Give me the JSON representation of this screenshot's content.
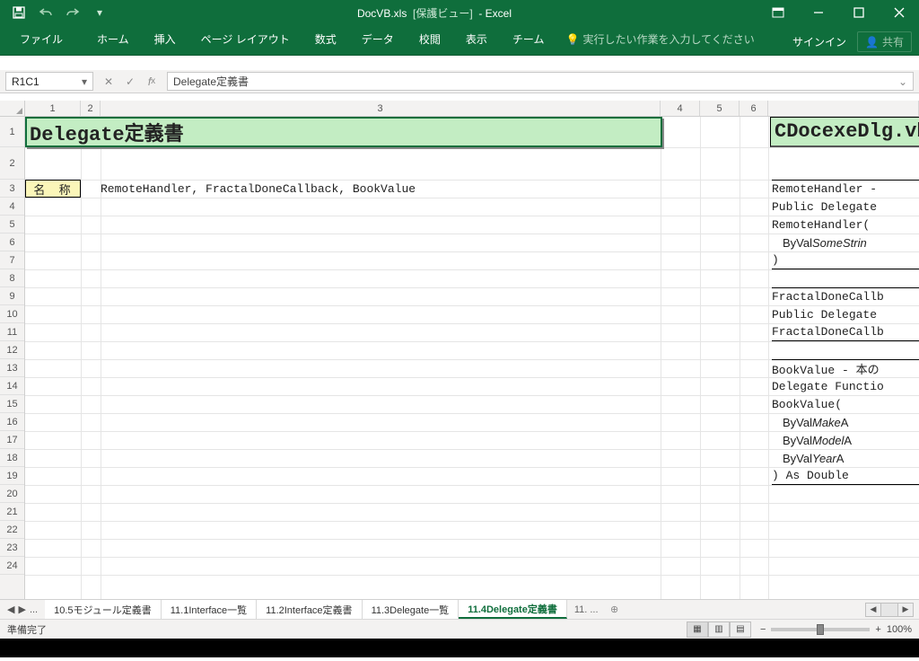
{
  "titlebar": {
    "filename": "DocVB.xls",
    "mode": "[保護ビュー]",
    "app": "Excel"
  },
  "ribbon": {
    "tabs": [
      "ファイル",
      "ホーム",
      "挿入",
      "ページ レイアウト",
      "数式",
      "データ",
      "校閲",
      "表示",
      "チーム"
    ],
    "tell": "実行したい作業を入力してください",
    "signin": "サインイン",
    "share": "共有"
  },
  "fx": {
    "namebox": "R1C1",
    "formula": "Delegate定義書"
  },
  "columns": [
    "1",
    "2",
    "3",
    "4",
    "5",
    "6"
  ],
  "rows": [
    "1",
    "2",
    "3",
    "4",
    "5",
    "6",
    "7",
    "8",
    "9",
    "10",
    "11",
    "12",
    "13",
    "14",
    "15",
    "16",
    "17",
    "18",
    "19",
    "20",
    "21",
    "22",
    "23",
    "24"
  ],
  "cells": {
    "title_left": "Delegate定義書",
    "title_right": "CDocexeDlg.vb",
    "row3_label": "名 称",
    "row3_value": "RemoteHandler, FractalDoneCallback, BookValue"
  },
  "code": {
    "l3": "RemoteHandler -",
    "l4": "Public Delegate ",
    "l5": "RemoteHandler(",
    "l6a": "ByVal ",
    "l6b": "SomeStrin",
    "l7": ")",
    "l9": "FractalDoneCallb",
    "l10": "Public Delegate ",
    "l11": "FractalDoneCallb",
    "l13": "BookValue - 本の",
    "l14": "Delegate Functio",
    "l15": "BookValue(",
    "l16a": "ByVal ",
    "l16b": "Make",
    "l16c": "   A",
    "l17a": "ByVal ",
    "l17b": "Model",
    "l17c": "  A",
    "l18a": "ByVal ",
    "l18b": "Year",
    "l18c": "   A",
    "l19": ") As Double"
  },
  "sheets": {
    "ellipsis_left": "...",
    "tabs": [
      "10.5モジュール定義書",
      "11.1Interface一覧",
      "11.2Interface定義書",
      "11.3Delegate一覧",
      "11.4Delegate定義書"
    ],
    "active_index": 4,
    "more": "11. ..."
  },
  "status": {
    "ready": "準備完了",
    "zoom": "100%"
  }
}
